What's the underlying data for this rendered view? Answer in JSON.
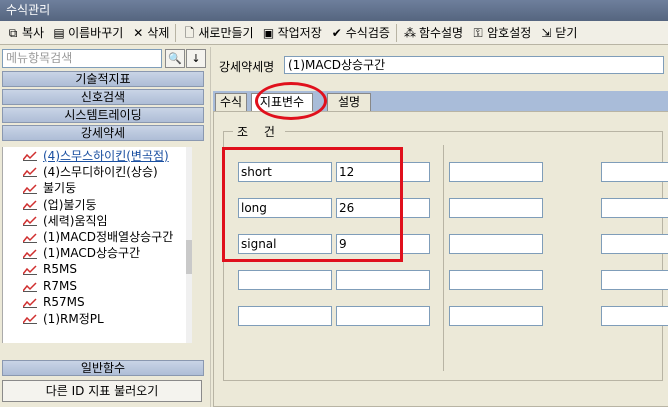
{
  "window": {
    "title": "수식관리"
  },
  "toolbar": {
    "copy": "복사",
    "rename": "이름바꾸기",
    "delete": "삭제",
    "new": "새로만들기",
    "save": "작업저장",
    "verify": "수식검증",
    "func_help": "함수설명",
    "password": "암호설정",
    "close": "닫기"
  },
  "left": {
    "search_placeholder": "메뉴항목검색",
    "categories": [
      "기술적지표",
      "신호검색",
      "시스템트레이딩",
      "강세약세"
    ],
    "tree_items": [
      "(4)스무스하이킨(변곡점)",
      "(4)스무디하이킨(상승)",
      "불기둥",
      "(업)불기둥",
      "(세력)움직임",
      "(1)MACD정배열상승구간",
      "(1)MACD상승구간",
      "R5MS",
      "R7MS",
      "R57MS",
      "(1)RM정PL"
    ],
    "general_functions": "일반함수",
    "load_other": "다른 ID 지표 불러오기"
  },
  "right": {
    "name_label": "강세약세명",
    "name_value": "(1)MACD상승구간",
    "tabs": [
      "수식",
      "지표변수",
      "설명"
    ],
    "group_title": "조 건",
    "variables": [
      {
        "name": "short",
        "value": "12"
      },
      {
        "name": "long",
        "value": "26"
      },
      {
        "name": "signal",
        "value": "9"
      },
      {
        "name": "",
        "value": ""
      },
      {
        "name": "",
        "value": ""
      }
    ]
  }
}
